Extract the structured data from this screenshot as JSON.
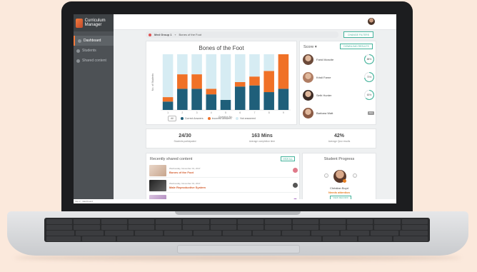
{
  "app": {
    "name": "Curriculum Manager",
    "status_url": "http://.../dashboard"
  },
  "sidebar": {
    "items": [
      {
        "label": "Dashboard",
        "icon": "home-icon",
        "active": true
      },
      {
        "label": "Students",
        "icon": "user-icon",
        "active": false
      },
      {
        "label": "Shared content",
        "icon": "folder-icon",
        "active": false
      }
    ]
  },
  "filter": {
    "group": "Med Group 1",
    "content": "Bones of the Foot",
    "change_label": "CHANGE FILTERS"
  },
  "chart_data": {
    "type": "bar",
    "stacked": true,
    "title": "Bones of the Foot",
    "xlabel": "Question No.",
    "ylabel": "No. of Students",
    "ylim": [
      0,
      100
    ],
    "categories": [
      "1",
      "2",
      "3",
      "4",
      "5",
      "6",
      "7",
      "8",
      "9"
    ],
    "series": [
      {
        "name": "Correct Answers",
        "color": "#1f5f7a",
        "values": [
          15,
          38,
          38,
          28,
          18,
          42,
          44,
          32,
          38
        ]
      },
      {
        "name": "Incorrect answers",
        "color": "#f07127",
        "values": [
          8,
          26,
          26,
          10,
          0,
          8,
          16,
          38,
          62
        ]
      },
      {
        "name": "Not answered",
        "color": "#d6ecf3",
        "values": [
          77,
          36,
          36,
          62,
          82,
          50,
          40,
          30,
          0
        ]
      }
    ],
    "legend_all": "All",
    "legend": [
      "Correct Answers",
      "Incorrect answers",
      "Not answered"
    ]
  },
  "scores": {
    "title": "Score",
    "download_label": "DOWNLOAD RESULTS",
    "students": [
      {
        "name": "Farid Moncite",
        "score": "88%",
        "pct": 88,
        "color": "#44b39b"
      },
      {
        "name": "Kristi Farne",
        "score": "73%",
        "pct": 73,
        "color": "#44b39b"
      },
      {
        "name": "Seth Hunter",
        "score": "63%",
        "pct": 63,
        "color": "#44b39b"
      },
      {
        "name": "Barbara Watt",
        "score": "N/A",
        "pct": 0,
        "color": "#999999"
      }
    ]
  },
  "stats": [
    {
      "value": "24/30",
      "label": "Students participated"
    },
    {
      "value": "163 Mins",
      "label": "Average completion time"
    },
    {
      "value": "42%",
      "label": "Average Quiz results"
    }
  ],
  "recent": {
    "title": "Recently shared content",
    "view_all": "VIEW ALL",
    "items": [
      {
        "date": "Wednesday, November 01, 2017",
        "title": "Bones of the Foot"
      },
      {
        "date": "Wednesday, November 01, 2017",
        "title": "Male Reproductive System"
      },
      {
        "date": "...tober 31, 2017",
        "title": ""
      }
    ]
  },
  "progress": {
    "title": "Student Progress",
    "student": "Christian Boyd",
    "status": "Needs attention",
    "view_label": "VIEW RECORD"
  }
}
